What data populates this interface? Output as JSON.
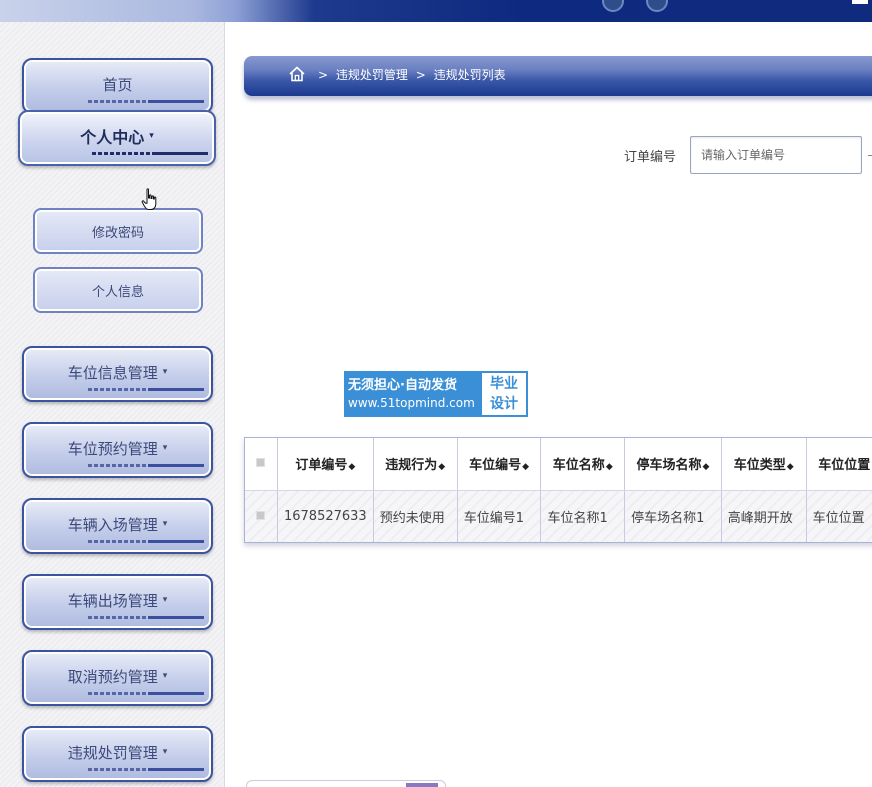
{
  "sidebar": {
    "items": [
      {
        "label": "首页",
        "caret": ""
      },
      {
        "label": "个人中心",
        "caret": "▾"
      },
      {
        "label": "车位信息管理",
        "caret": "▾"
      },
      {
        "label": "车位预约管理",
        "caret": "▾"
      },
      {
        "label": "车辆入场管理",
        "caret": "▾"
      },
      {
        "label": "车辆出场管理",
        "caret": "▾"
      },
      {
        "label": "取消预约管理",
        "caret": "▾"
      },
      {
        "label": "违规处罚管理",
        "caret": "▾"
      }
    ],
    "sub_items": [
      {
        "label": "修改密码"
      },
      {
        "label": "个人信息"
      }
    ]
  },
  "breadcrumb": {
    "home_icon": "home-icon",
    "separator": ">",
    "items": [
      "违规处罚管理",
      "违规处罚列表"
    ]
  },
  "search": {
    "label": "订单编号",
    "placeholder": "请输入订单编号",
    "value": ""
  },
  "watermark": {
    "line1": "无须担心·自动发货",
    "line2": "www.51topmind.com",
    "right1": "毕业",
    "right2": "设计"
  },
  "table": {
    "headers": [
      "订单编号",
      "违规行为",
      "车位编号",
      "车位名称",
      "停车场名称",
      "车位类型",
      "车位位置"
    ],
    "rows": [
      [
        "1678527633",
        "预约未使用",
        "车位编号1",
        "车位名称1",
        "停车场名称1",
        "高峰期开放",
        "车位位置"
      ]
    ]
  },
  "colors": {
    "accent": "#1b3a8f",
    "sidebar_border": "#3b53a0",
    "watermark_blue": "#3a8fd6"
  }
}
